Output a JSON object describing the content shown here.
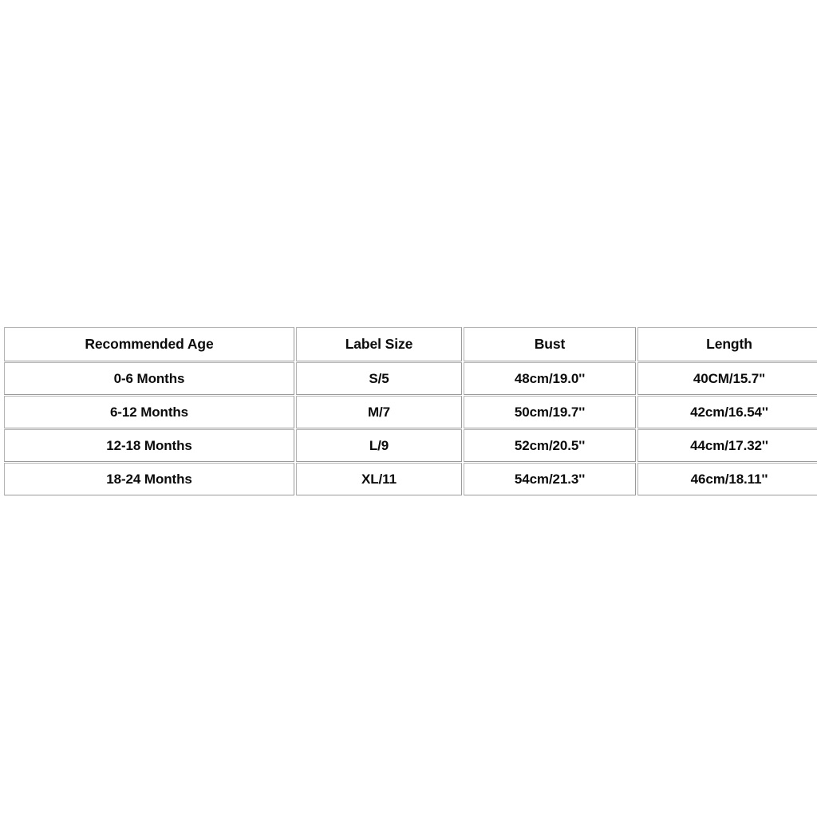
{
  "page": {
    "background_color": "#ffffff",
    "text_color": "#0b0b0b",
    "border_color": "#9a9a9a"
  },
  "size_chart": {
    "columns": [
      {
        "key": "age",
        "label": "Recommended Age"
      },
      {
        "key": "label",
        "label": "Label Size"
      },
      {
        "key": "bust",
        "label": "Bust"
      },
      {
        "key": "length",
        "label": "Length"
      }
    ],
    "rows": [
      {
        "age": "0-6 Months",
        "label": "S/5",
        "bust": "48cm/19.0''",
        "length": "40CM/15.7\""
      },
      {
        "age": "6-12 Months",
        "label": "M/7",
        "bust": "50cm/19.7''",
        "length": "42cm/16.54''"
      },
      {
        "age": "12-18 Months",
        "label": "L/9",
        "bust": "52cm/20.5''",
        "length": "44cm/17.32''"
      },
      {
        "age": "18-24 Months",
        "label": "XL/11",
        "bust": "54cm/21.3''",
        "length": "46cm/18.11''"
      }
    ]
  }
}
